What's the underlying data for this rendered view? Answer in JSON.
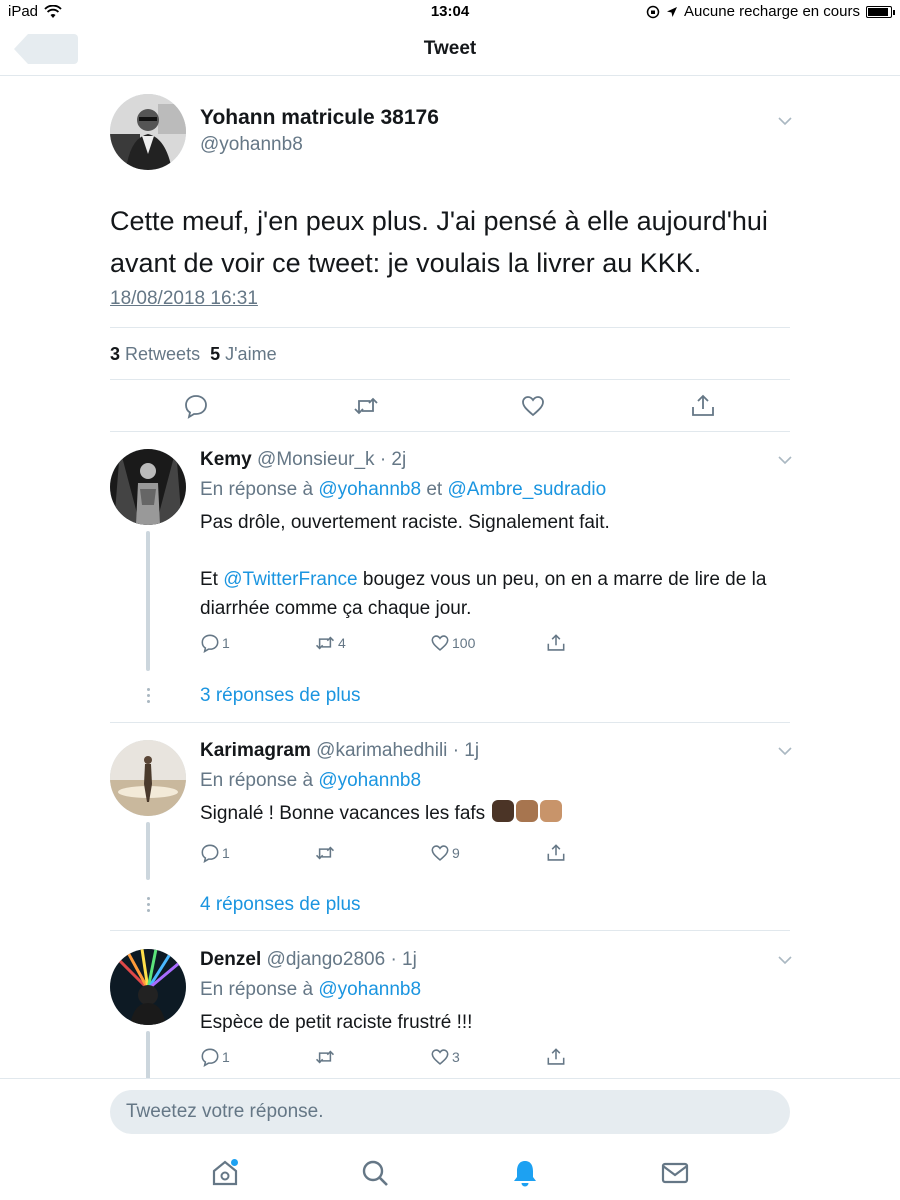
{
  "status_bar": {
    "device": "iPad",
    "time": "13:04",
    "charging_text": "Aucune recharge en cours"
  },
  "nav": {
    "title": "Tweet"
  },
  "main_tweet": {
    "name": "Yohann matricule 38176",
    "handle": "@yohannb8",
    "text": "Cette meuf, j'en peux plus. J'ai pensé à elle aujourd'hui avant de voir ce tweet: je voulais la livrer au KKK.",
    "date": "18/08/2018 16:31",
    "retweet_count": "3",
    "retweet_label": "Retweets",
    "like_count": "5",
    "like_label": "J'aime"
  },
  "replies": [
    {
      "name": "Kemy",
      "handle": "@Monsieur_k",
      "time": "· 2j",
      "in_reply_prefix": "En réponse à",
      "mention1": "@yohannb8",
      "conj": "et",
      "mention2": "@Ambre_sudradio",
      "line1": "Pas drôle, ouvertement raciste. Signalement fait.",
      "line2_prefix": "Et",
      "line2_mention": "@TwitterFrance",
      "line2_rest": "bougez vous un peu, on en a marre de lire de la diarrhée comme ça chaque jour.",
      "reply_count": "1",
      "retweet_count": "4",
      "like_count": "100",
      "more": "3 réponses de plus"
    },
    {
      "name": "Karimagram",
      "handle": "@karimahedhili",
      "time": "· 1j",
      "in_reply_prefix": "En réponse à",
      "mention1": "@yohannb8",
      "text": "Signalé ! Bonne vacances les fafs",
      "emojis": [
        "raised-fist-dark",
        "raised-fist-medium",
        "raised-fist-medium-light"
      ],
      "reply_count": "1",
      "retweet_count": "",
      "like_count": "9",
      "more": "4 réponses de plus"
    },
    {
      "name": "Denzel",
      "handle": "@django2806",
      "time": "· 1j",
      "in_reply_prefix": "En réponse à",
      "mention1": "@yohannb8",
      "text": "Espèce de petit raciste frustré !!!",
      "reply_count": "1",
      "retweet_count": "",
      "like_count": "3"
    }
  ],
  "composer": {
    "placeholder": "Tweetez votre réponse."
  },
  "colors": {
    "accent": "#1b95e0",
    "secondary_text": "#657786",
    "divider": "#e1e8ed"
  },
  "tabs": [
    "home-icon",
    "search-icon",
    "notifications-icon",
    "messages-icon"
  ]
}
